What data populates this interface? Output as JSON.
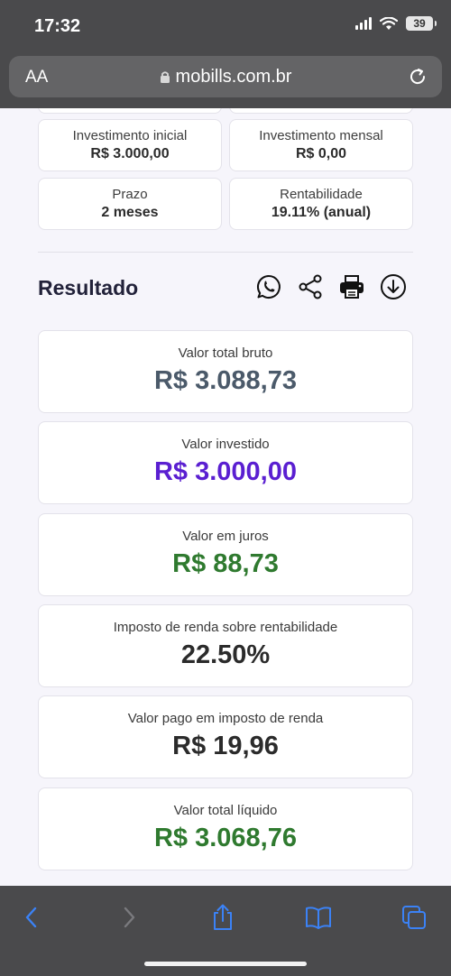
{
  "status": {
    "time": "17:32",
    "battery": "39"
  },
  "browser": {
    "aa": "AA",
    "url": "mobills.com.br"
  },
  "inputs_summary": [
    {
      "label": "Investimento inicial",
      "value": "R$ 3.000,00"
    },
    {
      "label": "Investimento mensal",
      "value": "R$ 0,00"
    },
    {
      "label": "Prazo",
      "value": "2 meses"
    },
    {
      "label": "Rentabilidade",
      "value": "19.11% (anual)"
    }
  ],
  "result": {
    "title": "Resultado",
    "share_icons": [
      "whatsapp-icon",
      "share-icon",
      "print-icon",
      "download-icon"
    ],
    "items": [
      {
        "label": "Valor total bruto",
        "value": "R$ 3.088,73",
        "color": "#4b5a6a"
      },
      {
        "label": "Valor investido",
        "value": "R$ 3.000,00",
        "color": "#5a1fd1"
      },
      {
        "label": "Valor em juros",
        "value": "R$ 88,73",
        "color": "#2f7a2f"
      },
      {
        "label": "Imposto de renda sobre rentabilidade",
        "value": "22.50%",
        "color": "#2b2b2b"
      },
      {
        "label": "Valor pago em imposto de renda",
        "value": "R$ 19,96",
        "color": "#2b2b2b"
      },
      {
        "label": "Valor total líquido",
        "value": "R$ 3.068,76",
        "color": "#2f7a2f"
      }
    ]
  },
  "toolbar": {
    "accent": "#3b82f6",
    "icons": [
      "back-icon",
      "forward-icon",
      "share-icon",
      "bookmarks-icon",
      "tabs-icon"
    ]
  }
}
